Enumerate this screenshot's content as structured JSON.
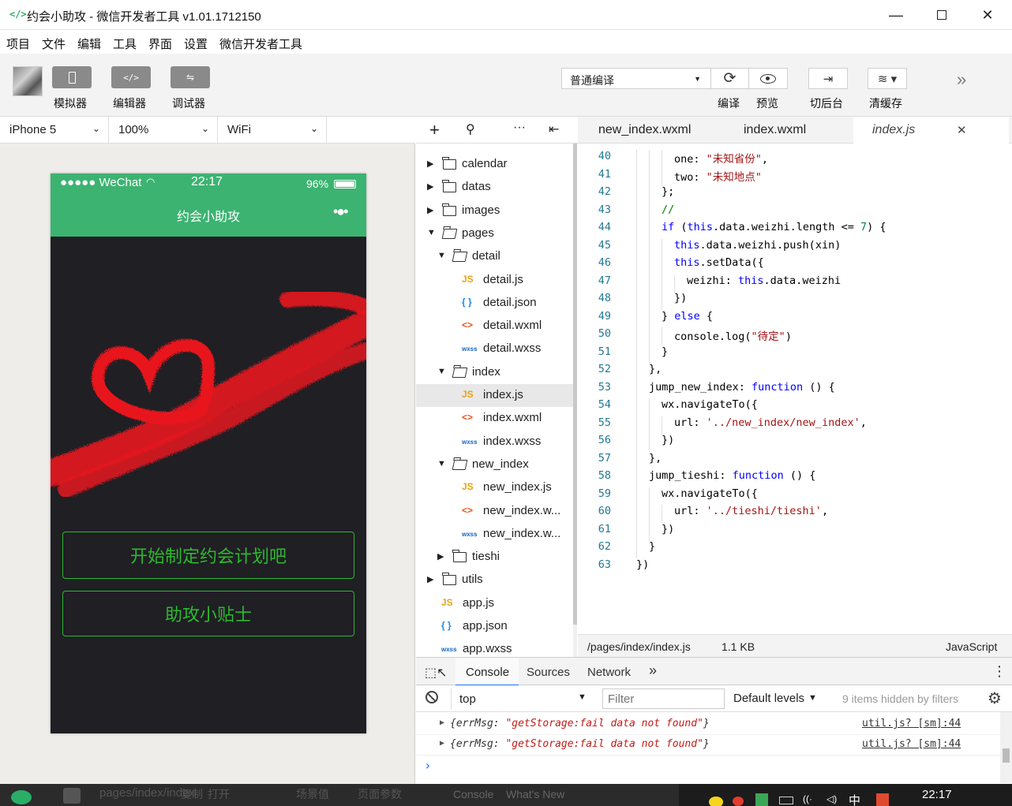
{
  "window": {
    "title": "约会小助攻 - 微信开发者工具 v1.01.1712150",
    "icon_glyph": "</>"
  },
  "menu": [
    "项目",
    "文件",
    "编辑",
    "工具",
    "界面",
    "设置",
    "微信开发者工具"
  ],
  "toolbar": {
    "simulator_label": "模拟器",
    "editor_label": "编辑器",
    "debugger_label": "调试器",
    "compile_mode": "普通编译",
    "compile_label": "编译",
    "preview_label": "预览",
    "background_label": "切后台",
    "clear_cache_label": "清缓存"
  },
  "simulator": {
    "device": "iPhone 5",
    "zoom": "100%",
    "network": "WiFi",
    "status_carrier": "●●●●● WeChat",
    "status_time": "22:17",
    "status_battery": "96%",
    "nav_title": "约会小助攻",
    "nav_menu": "•●•",
    "button_plan": "开始制定约会计划吧",
    "button_tips": "助攻小贴士"
  },
  "file_tree": [
    {
      "label": "calendar",
      "type": "folder",
      "depth": 0,
      "open": false
    },
    {
      "label": "datas",
      "type": "folder",
      "depth": 0,
      "open": false
    },
    {
      "label": "images",
      "type": "folder",
      "depth": 0,
      "open": false
    },
    {
      "label": "pages",
      "type": "folder",
      "depth": 0,
      "open": true
    },
    {
      "label": "detail",
      "type": "folder",
      "depth": 1,
      "open": true
    },
    {
      "label": "detail.js",
      "type": "js",
      "depth": 2
    },
    {
      "label": "detail.json",
      "type": "json",
      "depth": 2
    },
    {
      "label": "detail.wxml",
      "type": "wxml",
      "depth": 2
    },
    {
      "label": "detail.wxss",
      "type": "wxss",
      "depth": 2
    },
    {
      "label": "index",
      "type": "folder",
      "depth": 1,
      "open": true
    },
    {
      "label": "index.js",
      "type": "js",
      "depth": 2,
      "selected": true
    },
    {
      "label": "index.wxml",
      "type": "wxml",
      "depth": 2
    },
    {
      "label": "index.wxss",
      "type": "wxss",
      "depth": 2
    },
    {
      "label": "new_index",
      "type": "folder",
      "depth": 1,
      "open": true
    },
    {
      "label": "new_index.js",
      "type": "js",
      "depth": 2
    },
    {
      "label": "new_index.w...",
      "type": "wxml",
      "depth": 2
    },
    {
      "label": "new_index.w...",
      "type": "wxss",
      "depth": 2
    },
    {
      "label": "tieshi",
      "type": "folder",
      "depth": 1,
      "open": false
    },
    {
      "label": "utils",
      "type": "folder",
      "depth": 0,
      "open": false
    },
    {
      "label": "app.js",
      "type": "js",
      "depth": 0
    },
    {
      "label": "app.json",
      "type": "json",
      "depth": 0
    },
    {
      "label": "app.wxss",
      "type": "wxss",
      "depth": 0
    }
  ],
  "file_icons": {
    "js": "JS",
    "json": "{ }",
    "wxml": "<>",
    "wxss": "wxss"
  },
  "editor": {
    "tabs": [
      "new_index.wxml",
      "index.wxml",
      "index.js"
    ],
    "active_tab": "index.js",
    "close_glyph": "✕",
    "file_path": "/pages/index/index.js",
    "file_size": "1.1 KB",
    "language": "JavaScript",
    "lines": [
      {
        "n": "40",
        "indent": 3,
        "tokens": [
          [
            "p",
            "one: "
          ],
          [
            "s",
            "\"未知省份\""
          ],
          [
            "p",
            ","
          ]
        ]
      },
      {
        "n": "41",
        "indent": 3,
        "tokens": [
          [
            "p",
            "two: "
          ],
          [
            "s",
            "\"未知地点\""
          ]
        ]
      },
      {
        "n": "42",
        "indent": 2,
        "tokens": [
          [
            "p",
            "};"
          ]
        ]
      },
      {
        "n": "43",
        "indent": 2,
        "tokens": [
          [
            "c",
            "//"
          ]
        ]
      },
      {
        "n": "44",
        "indent": 2,
        "tokens": [
          [
            "k",
            "if"
          ],
          [
            "p",
            " ("
          ],
          [
            "k",
            "this"
          ],
          [
            "p",
            ".data.weizhi.length <= "
          ],
          [
            "c",
            "7"
          ],
          [
            "p",
            ") {"
          ]
        ]
      },
      {
        "n": "45",
        "indent": 3,
        "tokens": [
          [
            "k",
            "this"
          ],
          [
            "p",
            ".data.weizhi.push(xin)"
          ]
        ]
      },
      {
        "n": "46",
        "indent": 3,
        "tokens": [
          [
            "k",
            "this"
          ],
          [
            "p",
            ".setData({"
          ]
        ]
      },
      {
        "n": "47",
        "indent": 4,
        "tokens": [
          [
            "p",
            "weizhi: "
          ],
          [
            "k",
            "this"
          ],
          [
            "p",
            ".data.weizhi"
          ]
        ]
      },
      {
        "n": "48",
        "indent": 3,
        "tokens": [
          [
            "p",
            "})"
          ]
        ]
      },
      {
        "n": "49",
        "indent": 2,
        "tokens": [
          [
            "p",
            "} "
          ],
          [
            "k",
            "else"
          ],
          [
            "p",
            " {"
          ]
        ]
      },
      {
        "n": "50",
        "indent": 3,
        "tokens": [
          [
            "p",
            "console.log("
          ],
          [
            "s",
            "\"待定\""
          ],
          [
            "p",
            ")"
          ]
        ]
      },
      {
        "n": "51",
        "indent": 2,
        "tokens": [
          [
            "p",
            "}"
          ]
        ]
      },
      {
        "n": "52",
        "indent": 1,
        "tokens": [
          [
            "p",
            "},"
          ]
        ]
      },
      {
        "n": "53",
        "indent": 1,
        "tokens": [
          [
            "p",
            "jump_new_index: "
          ],
          [
            "k",
            "function"
          ],
          [
            "p",
            " () {"
          ]
        ]
      },
      {
        "n": "54",
        "indent": 2,
        "tokens": [
          [
            "p",
            "wx.navigateTo({"
          ]
        ]
      },
      {
        "n": "55",
        "indent": 3,
        "tokens": [
          [
            "p",
            "url: "
          ],
          [
            "s",
            "'../new_index/new_index'"
          ],
          [
            "p",
            ","
          ]
        ]
      },
      {
        "n": "56",
        "indent": 2,
        "tokens": [
          [
            "p",
            "})"
          ]
        ]
      },
      {
        "n": "57",
        "indent": 1,
        "tokens": [
          [
            "p",
            "},"
          ]
        ]
      },
      {
        "n": "58",
        "indent": 1,
        "tokens": [
          [
            "p",
            "jump_tieshi: "
          ],
          [
            "k",
            "function"
          ],
          [
            "p",
            " () {"
          ]
        ]
      },
      {
        "n": "59",
        "indent": 2,
        "tokens": [
          [
            "p",
            "wx.navigateTo({"
          ]
        ]
      },
      {
        "n": "60",
        "indent": 3,
        "tokens": [
          [
            "p",
            "url: "
          ],
          [
            "s",
            "'../tieshi/tieshi'"
          ],
          [
            "p",
            ","
          ]
        ]
      },
      {
        "n": "61",
        "indent": 2,
        "tokens": [
          [
            "p",
            "})"
          ]
        ]
      },
      {
        "n": "62",
        "indent": 1,
        "tokens": [
          [
            "p",
            "}"
          ]
        ]
      },
      {
        "n": "63",
        "indent": 0,
        "tokens": [
          [
            "p",
            "})"
          ]
        ]
      }
    ]
  },
  "devtools": {
    "tabs": [
      "Console",
      "Sources",
      "Network"
    ],
    "more": "»",
    "context": "top",
    "filter_placeholder": "Filter",
    "levels": "Default levels",
    "hidden_note": "9 items hidden by filters",
    "messages": [
      {
        "key": "errMsg",
        "value": "\"getStorage:fail data not found\"",
        "source": "util.js? [sm]:44"
      },
      {
        "key": "errMsg",
        "value": "\"getStorage:fail data not found\"",
        "source": "util.js? [sm]:44"
      }
    ],
    "prompt": "›"
  },
  "bottom": {
    "page_path": "pages/index/index",
    "copy": "复制",
    "open": "打开",
    "scene": "场景值",
    "params": "页面参数",
    "tab1": "Console",
    "tab2": "What's New",
    "clock": "22:17",
    "ime": "中"
  },
  "colors": {
    "wechat_green": "#3cb371",
    "button_green": "#2eb82e",
    "phone_bg": "#1f1f24",
    "keyword": "#0000ff",
    "string": "#a31515",
    "heart_red": "#e8141e"
  }
}
